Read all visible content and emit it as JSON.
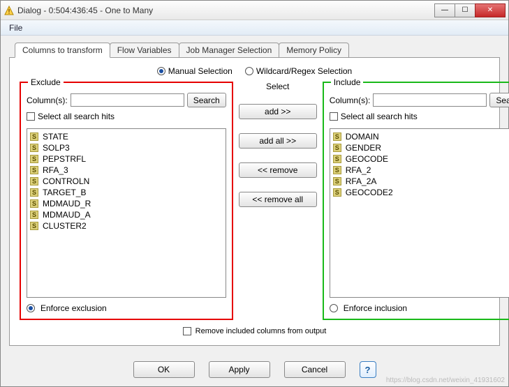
{
  "titlebar": {
    "title": "Dialog - 0:504:436:45 - One to Many"
  },
  "menubar": {
    "file": "File"
  },
  "tabs": [
    {
      "label": "Columns to transform",
      "active": true
    },
    {
      "label": "Flow Variables",
      "active": false
    },
    {
      "label": "Job Manager Selection",
      "active": false
    },
    {
      "label": "Memory Policy",
      "active": false
    }
  ],
  "selection_mode": {
    "manual": {
      "label": "Manual Selection",
      "checked": true
    },
    "regex": {
      "label": "Wildcard/Regex Selection",
      "checked": false
    }
  },
  "exclude": {
    "legend": "Exclude",
    "columns_label": "Column(s):",
    "search_btn": "Search",
    "select_all": "Select all search hits",
    "items": [
      "STATE",
      "SOLP3",
      "PEPSTRFL",
      "RFA_3",
      "CONTROLN",
      "TARGET_B",
      "MDMAUD_R",
      "MDMAUD_A",
      "CLUSTER2"
    ],
    "enforce": {
      "label": "Enforce exclusion",
      "checked": true
    }
  },
  "select": {
    "legend": "Select",
    "add": "add >>",
    "add_all": "add all >>",
    "remove": "<< remove",
    "remove_all": "<< remove all"
  },
  "include": {
    "legend": "Include",
    "columns_label": "Column(s):",
    "search_btn": "Search",
    "select_all": "Select all search hits",
    "items": [
      "DOMAIN",
      "GENDER",
      "GEOCODE",
      "RFA_2",
      "RFA_2A",
      "GEOCODE2"
    ],
    "enforce": {
      "label": "Enforce inclusion",
      "checked": false
    }
  },
  "remove_included": {
    "label": "Remove included columns from output",
    "checked": false
  },
  "buttons": {
    "ok": "OK",
    "apply": "Apply",
    "cancel": "Cancel"
  },
  "watermark": "https://blog.csdn.net/weixin_41931602"
}
